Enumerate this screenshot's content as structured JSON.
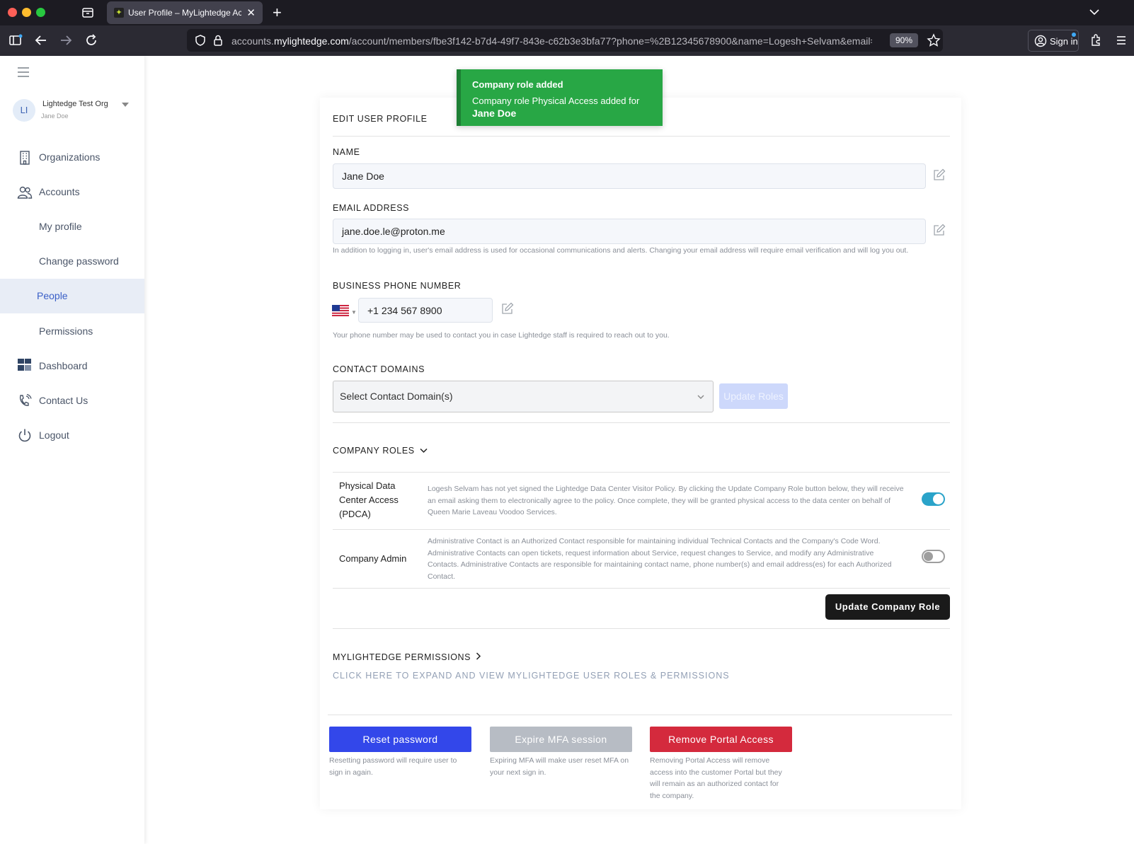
{
  "browser": {
    "tab_title": "User Profile – MyLightedge Account",
    "url_prefix": "accounts.",
    "url_domain": "mylightedge.com",
    "url_path": "/account/members/fbe3f142-b7d4-49f7-843e-c62b3e3bfa77?phone=%2B12345678900&name=Logesh+Selvam&email=",
    "zoom": "90%",
    "signin_label": "Sign in"
  },
  "sidebar": {
    "org_initials": "LI",
    "org_name": "Lightedge Test Org",
    "org_user": "Jane Doe",
    "items": [
      {
        "label": "Organizations"
      },
      {
        "label": "Accounts"
      },
      {
        "label": "My profile"
      },
      {
        "label": "Change password"
      },
      {
        "label": "People"
      },
      {
        "label": "Permissions"
      },
      {
        "label": "Dashboard"
      },
      {
        "label": "Contact Us"
      },
      {
        "label": "Logout"
      }
    ]
  },
  "toast": {
    "title": "Company role added",
    "message": "Company role Physical Access added for",
    "name": "Jane Doe"
  },
  "profile": {
    "heading": "EDIT USER PROFILE",
    "name_label": "NAME",
    "name_value": "Jane Doe",
    "email_label": "EMAIL ADDRESS",
    "email_value": "jane.doe.le@proton.me",
    "email_help": "In addition to logging in, user's email address is used for occasional communications and alerts. Changing your email address will require email verification and will log you out.",
    "phone_label": "BUSINESS PHONE NUMBER",
    "phone_value": "+1 234 567 8900",
    "phone_help": "Your phone number may be used to contact you in case Lightedge staff is required to reach out to you.",
    "domains_label": "CONTACT DOMAINS",
    "domains_placeholder": "Select Contact Domain(s)",
    "update_roles_label": "Update Roles"
  },
  "company_roles": {
    "heading": "COMPANY ROLES",
    "roles": [
      {
        "title": "Physical Data Center Access (PDCA)",
        "description": "Logesh Selvam has not yet signed the Lightedge Data Center Visitor Policy. By clicking the Update Company Role button below, they will receive an email asking them to electronically agree to the policy. Once complete, they will be granted physical access to the data center on behalf of Queen Marie Laveau Voodoo Services.",
        "enabled": true
      },
      {
        "title": "Company Admin",
        "description": "Administrative Contact is an Authorized Contact responsible for maintaining individual Technical Contacts and the Company's Code Word. Administrative Contacts can open tickets, request information about Service, request changes to Service, and modify any Administrative Contacts. Administrative Contacts are responsible for maintaining contact name, phone number(s) and email address(es) for each Authorized Contact.",
        "enabled": false
      }
    ],
    "update_button": "Update Company Role"
  },
  "permissions": {
    "heading": "MYLIGHTEDGE PERMISSIONS",
    "expand_link": "CLICK HERE TO EXPAND AND VIEW MYLIGHTEDGE USER ROLES & PERMISSIONS"
  },
  "actions": {
    "reset_label": "Reset password",
    "reset_help": "Resetting password will require user to sign in again.",
    "expire_label": "Expire MFA session",
    "expire_help": "Expiring MFA will make user reset MFA on your next sign in.",
    "remove_label": "Remove Portal Access",
    "remove_help": "Removing Portal Access will remove access into the customer Portal but they will remain as an authorized contact for the company."
  },
  "colors": {
    "toast_bg": "#28a745",
    "reset_btn": "#3347ea",
    "expire_btn": "#b7bcc4",
    "remove_btn": "#d42a3d",
    "toggle_on": "#2aa3c9",
    "active_nav": "#3a5fc7"
  }
}
